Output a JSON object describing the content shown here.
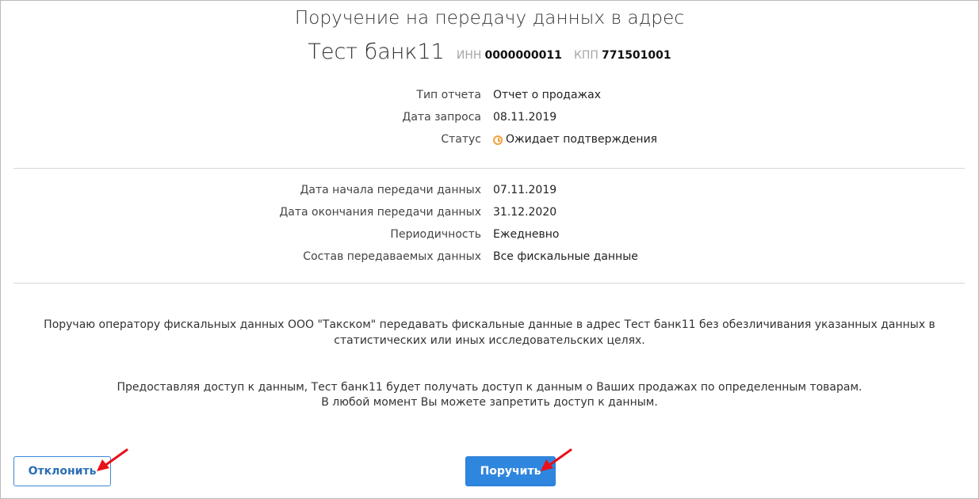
{
  "header": {
    "title": "Поручение на передачу данных в адрес",
    "org_name": "Тест банк11",
    "inn_label": "ИНН",
    "inn_value": "0000000011",
    "kpp_label": "КПП",
    "kpp_value": "771501001"
  },
  "request_info": [
    {
      "label": "Тип отчета",
      "value": "Отчет о продажах"
    },
    {
      "label": "Дата запроса",
      "value": "08.11.2019"
    },
    {
      "label": "Статус",
      "value": "Ожидает подтверждения",
      "icon": "clock-icon"
    }
  ],
  "transfer_info": [
    {
      "label": "Дата начала передачи данных",
      "value": "07.11.2019"
    },
    {
      "label": "Дата окончания передачи данных",
      "value": "31.12.2020"
    },
    {
      "label": "Периодичность",
      "value": "Ежедневно"
    },
    {
      "label": "Состав передаваемых данных",
      "value": "Все фискальные данные"
    }
  ],
  "texts": {
    "instruction": "Поручаю оператору фискальных данных ООО \"Такском\" передавать фискальные данные в адрес Тест банк11 без обезличивания указанных данных в статистических или иных исследовательских целях.",
    "access_line1": "Предоставляя доступ к данным, Тест банк11 будет получать доступ к данным о Ваших продажах по определенным товарам.",
    "access_line2": "В любой момент Вы можете запретить доступ к данным."
  },
  "buttons": {
    "decline_label": "Отклонить",
    "confirm_label": "Поручить"
  },
  "colors": {
    "accent": "#2f86de",
    "status_icon": "#f0a13a",
    "annotation_arrow": "#e8101a"
  }
}
